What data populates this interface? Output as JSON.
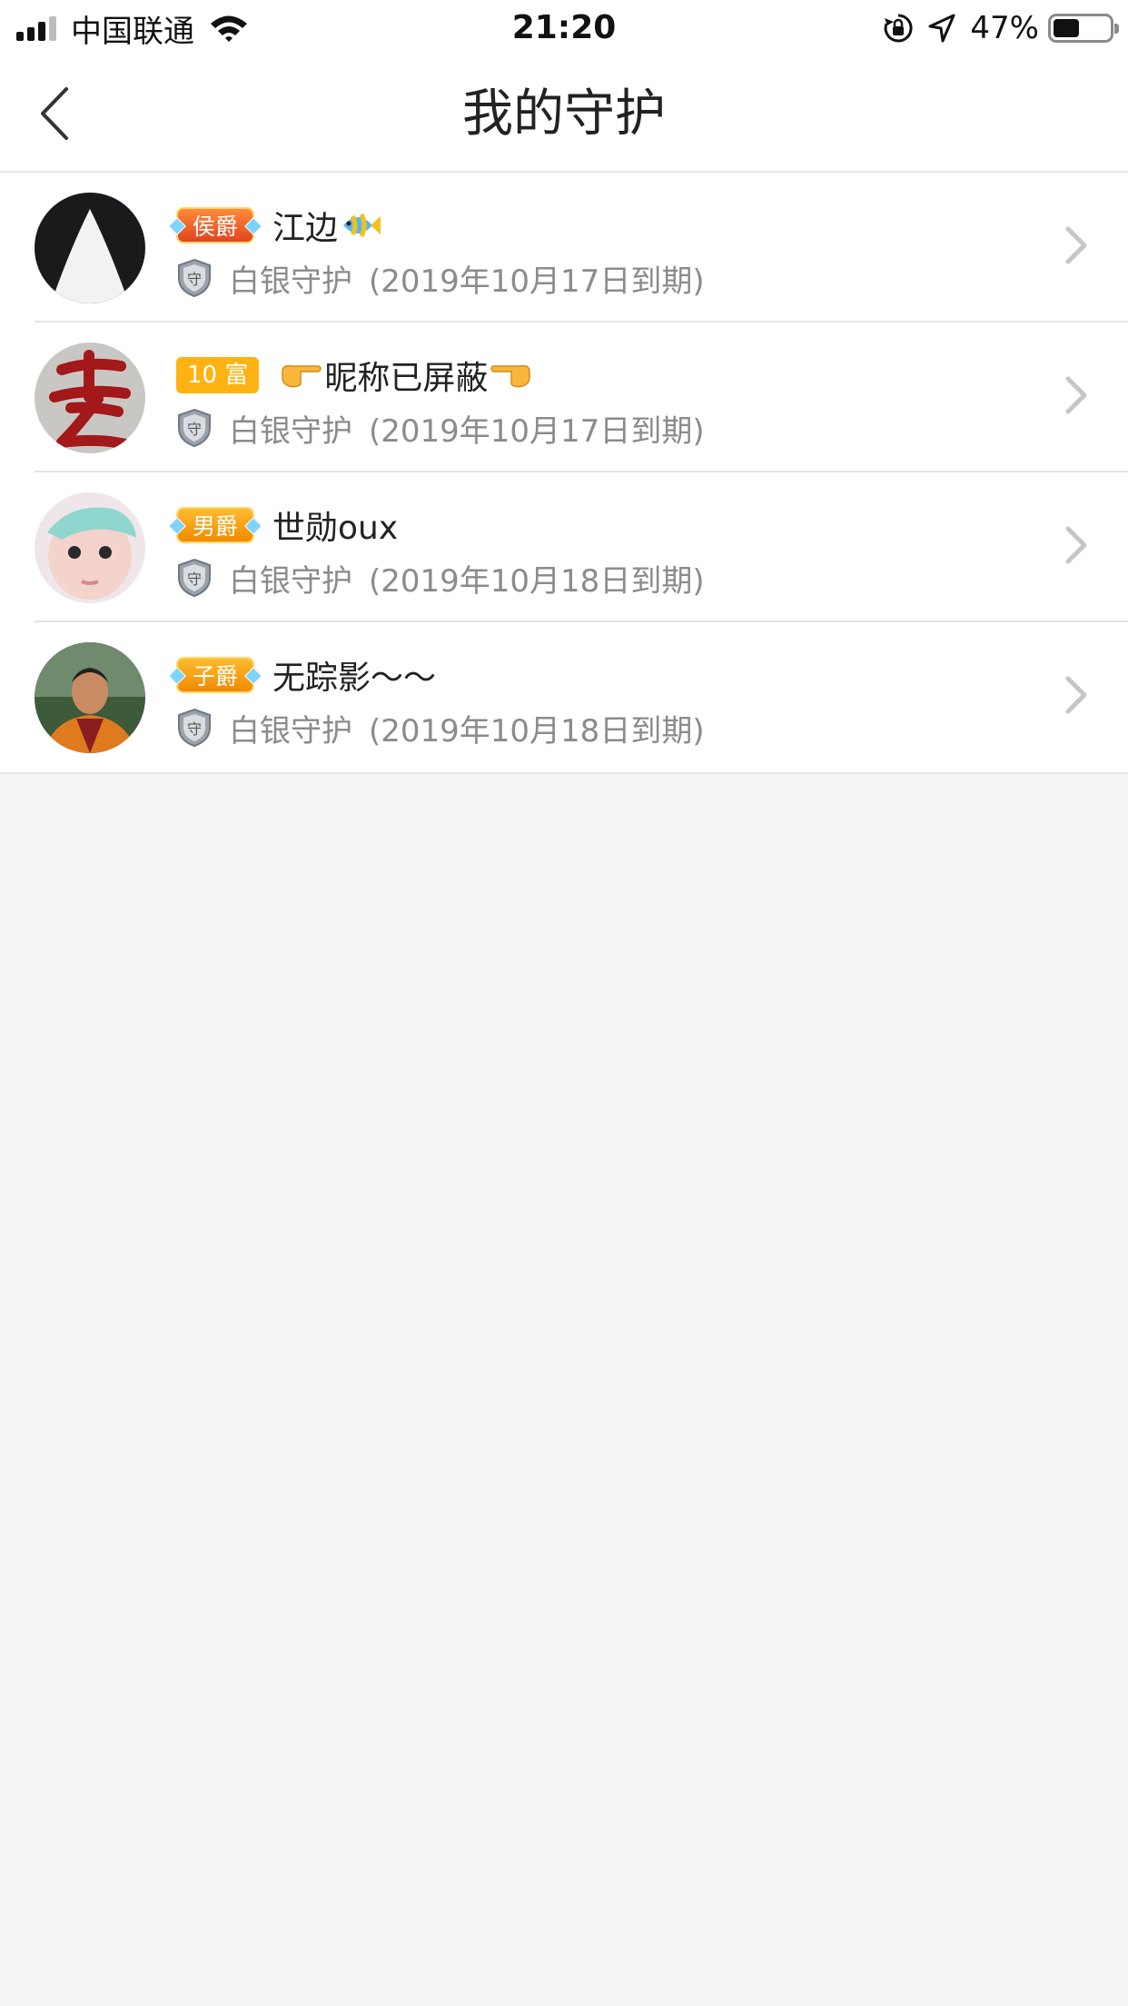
{
  "status": {
    "carrier": "中国联通",
    "time": "21:20",
    "battery_percent": "47%",
    "battery_level": 0.47
  },
  "nav": {
    "title": "我的守护"
  },
  "guard_list": [
    {
      "rank_badge": "侯爵",
      "nickname": "江边",
      "guard_type": "白银守护",
      "expiry": "(2019年10月17日到期)"
    },
    {
      "rank_badge": "10 富",
      "nickname": "昵称已屏蔽",
      "guard_type": "白银守护",
      "expiry": "(2019年10月17日到期)"
    },
    {
      "rank_badge": "男爵",
      "nickname": "世勋oux",
      "guard_type": "白银守护",
      "expiry": "(2019年10月18日到期)"
    },
    {
      "rank_badge": "子爵",
      "nickname": "无踪影～～",
      "guard_type": "白银守护",
      "expiry": "(2019年10月18日到期)"
    }
  ],
  "colors": {
    "background": "#f4f4f4",
    "title_text": "#222222",
    "secondary_text": "#8b8b8b",
    "badge_orange": "#f08a00",
    "badge_red": "#e0441f"
  }
}
